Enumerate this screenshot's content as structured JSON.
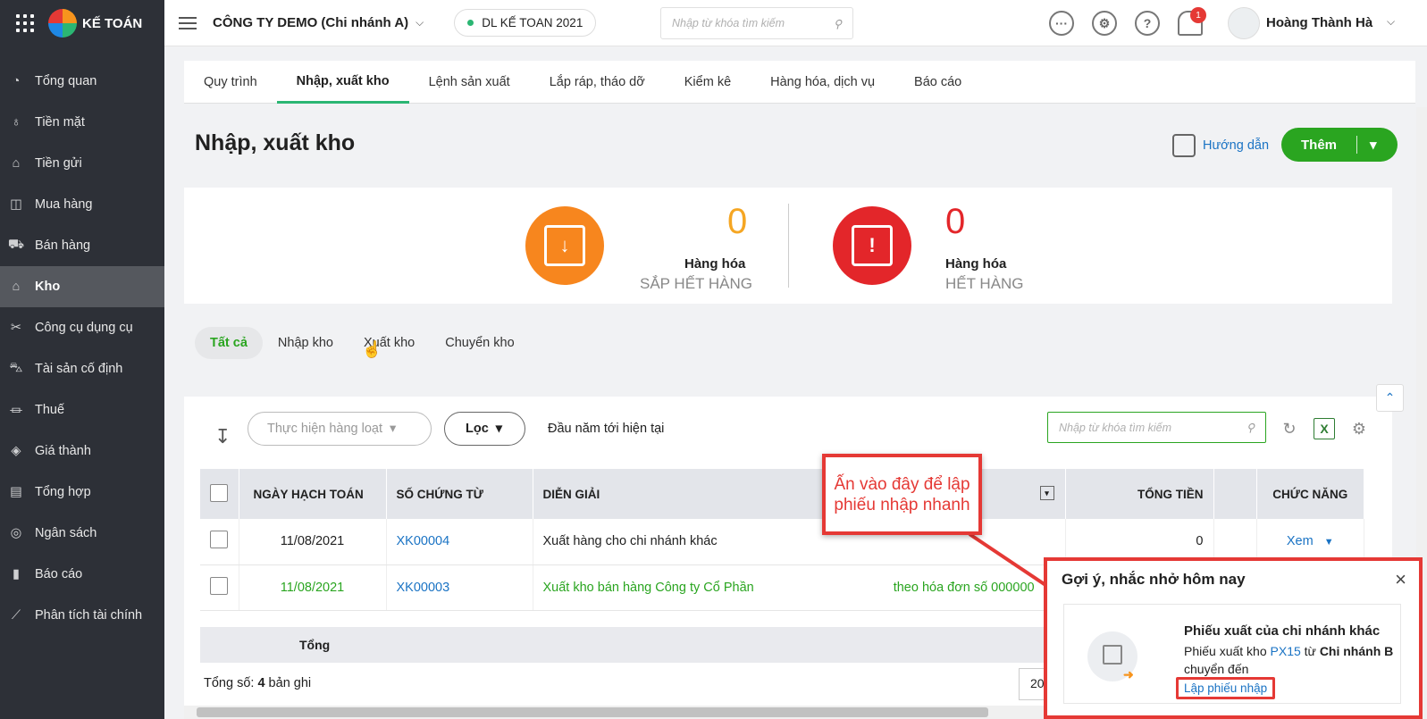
{
  "app": {
    "logo_text": "KẾ TOÁN"
  },
  "sidebar": {
    "items": [
      {
        "label": "Tổng quan",
        "icon": "chart-pie-icon"
      },
      {
        "label": "Tiền mặt",
        "icon": "money-bag-icon"
      },
      {
        "label": "Tiền gửi",
        "icon": "bank-icon"
      },
      {
        "label": "Mua hàng",
        "icon": "shopping-bag-icon"
      },
      {
        "label": "Bán hàng",
        "icon": "cart-icon"
      },
      {
        "label": "Kho",
        "icon": "warehouse-icon",
        "active": true
      },
      {
        "label": "Công cụ dụng cụ",
        "icon": "tools-icon"
      },
      {
        "label": "Tài sản cố định",
        "icon": "car-icon"
      },
      {
        "label": "Thuế",
        "icon": "government-icon"
      },
      {
        "label": "Giá thành",
        "icon": "price-tag-icon"
      },
      {
        "label": "Tổng hợp",
        "icon": "ledger-icon"
      },
      {
        "label": "Ngân sách",
        "icon": "budget-icon"
      },
      {
        "label": "Báo cáo",
        "icon": "bar-chart-icon"
      },
      {
        "label": "Phân tích tài chính",
        "icon": "trend-icon"
      }
    ]
  },
  "header": {
    "company": "CÔNG TY DEMO (Chi nhánh A)",
    "database": "DL KẾ TOAN 2021",
    "search_placeholder": "Nhập từ khóa tìm kiếm",
    "more_icon": "···",
    "help_icon": "?",
    "notification_count": "1",
    "user_name": "Hoàng Thành Hà"
  },
  "tabs": [
    {
      "label": "Quy trình"
    },
    {
      "label": "Nhập, xuất kho",
      "active": true
    },
    {
      "label": "Lệnh sản xuất"
    },
    {
      "label": "Lắp ráp, tháo dỡ"
    },
    {
      "label": "Kiểm kê"
    },
    {
      "label": "Hàng hóa, dịch vụ"
    },
    {
      "label": "Báo cáo"
    }
  ],
  "page": {
    "title": "Nhập, xuất kho",
    "guide_label": "Hướng dẫn",
    "add_label": "Thêm"
  },
  "summary": {
    "low_stock": {
      "count": "0",
      "label": "Hàng hóa",
      "sub": "SẮP HẾT HÀNG",
      "color": "#f7861e"
    },
    "out_stock": {
      "count": "0",
      "label": "Hàng hóa",
      "sub": "HẾT HÀNG",
      "color": "#e3262a"
    }
  },
  "filter_tabs": [
    {
      "label": "Tất cả",
      "active": true
    },
    {
      "label": "Nhập kho"
    },
    {
      "label": "Xuất kho"
    },
    {
      "label": "Chuyển kho"
    }
  ],
  "toolbar": {
    "bulk_action": "Thực hiện hàng loạt",
    "filter": "Lọc",
    "period": "Đầu năm tới hiện tại",
    "search_placeholder": "Nhập từ khóa tìm kiếm"
  },
  "table": {
    "columns": [
      "NGÀY HẠCH TOÁN",
      "SỐ CHỨNG TỪ",
      "DIỄN GIẢI",
      "TỔNG TIỀN",
      "CHỨC NĂNG"
    ],
    "rows": [
      {
        "date": "11/08/2021",
        "doc": "XK00004",
        "desc": "Xuất hàng cho chi nhánh khác",
        "desc_extra": "",
        "total": "0",
        "action": "Xem"
      },
      {
        "date": "11/08/2021",
        "doc": "XK00003",
        "desc": "Xuất kho bán hàng Công ty Cổ Phần",
        "desc_extra": "theo hóa đơn số 000000",
        "total": "",
        "action": ""
      }
    ],
    "total_label": "Tổng",
    "record_count_prefix": "Tổng số: ",
    "record_count": "4",
    "record_count_suffix": " bản ghi",
    "page_size": "20"
  },
  "callout": {
    "text": "Ấn vào đây để lập phiếu nhập nhanh"
  },
  "popup": {
    "title": "Gợi ý, nhắc nhở hôm nay",
    "close": "×",
    "heading": "Phiếu xuất của chi nhánh khác",
    "desc_1": "Phiếu xuất kho ",
    "desc_link": "PX15",
    "desc_2": " từ ",
    "desc_bold": "Chi nhánh B",
    "desc_3": " chuyển đến",
    "action": "Lập phiếu nhập"
  }
}
